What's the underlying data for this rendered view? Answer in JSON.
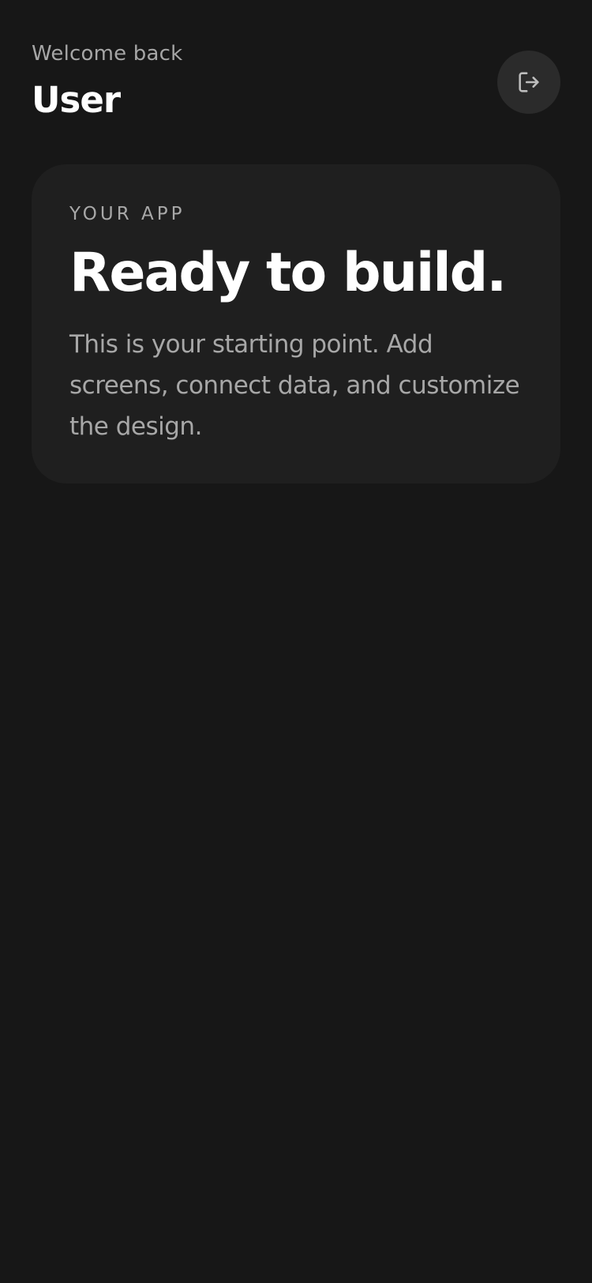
{
  "header": {
    "greeting": "Welcome back",
    "username": "User",
    "logout_icon": "logout-icon"
  },
  "card": {
    "eyebrow": "YOUR APP",
    "title": "Ready to build.",
    "body": "This is your starting point. Add screens, connect data, and customize the design."
  },
  "colors": {
    "background": "#171717",
    "card_background": "#1f1f1f",
    "button_background": "#2b2b2b",
    "primary_text": "#ffffff",
    "secondary_text": "#a6a6a6"
  }
}
